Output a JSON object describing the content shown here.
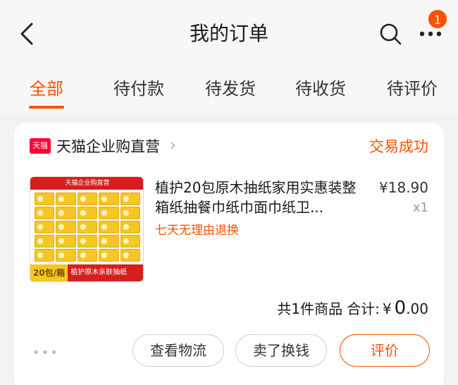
{
  "header": {
    "title": "我的订单",
    "badge_count": "1",
    "back_icon": "back-arrow-icon",
    "search_icon": "search-icon",
    "more_icon": "more-dots-icon"
  },
  "tabs": [
    {
      "label": "全部",
      "active": true
    },
    {
      "label": "待付款",
      "active": false
    },
    {
      "label": "待发货",
      "active": false
    },
    {
      "label": "待收货",
      "active": false
    },
    {
      "label": "待评价",
      "active": false
    }
  ],
  "order": {
    "shop": {
      "logo_text": "天猫",
      "name": "天猫企业购直营",
      "arrow": "›"
    },
    "status": "交易成功",
    "product": {
      "thumbnail": {
        "top_text": "天猫企业购直营",
        "count_text": "20包/箱",
        "caption": "植护原木亲肤抽纸"
      },
      "title": "植护20包原木抽纸家用实惠装整箱纸抽餐巾纸巾面巾纸卫...",
      "price": "¥18.90",
      "quantity": "x1",
      "return_policy": "七天无理由退换"
    },
    "summary": {
      "items_text": "共1件商品",
      "total_label": "合计:",
      "currency": "¥",
      "amount_int": "0",
      "amount_dec": ".00"
    },
    "more_dots": "•••",
    "actions": {
      "logistics": "查看物流",
      "resell": "卖了换钱",
      "review": "评价"
    }
  },
  "colors": {
    "accent": "#ff5000",
    "tmall_red": "#ff0036",
    "background": "#f2f2f2"
  }
}
